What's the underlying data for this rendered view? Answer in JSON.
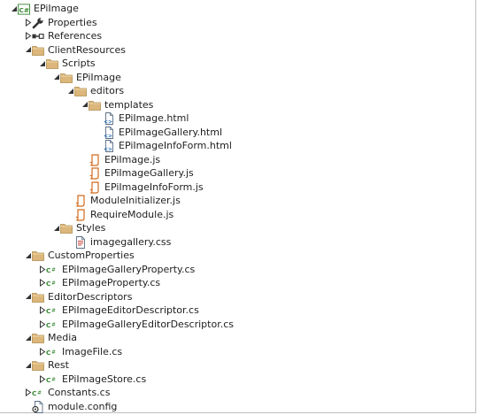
{
  "tree": {
    "items": [
      {
        "label": "EPiImage",
        "icon": "csproj-icon",
        "expander": "expanded"
      },
      {
        "label": "Properties",
        "icon": "wrench-icon",
        "expander": "collapsed"
      },
      {
        "label": "References",
        "icon": "references-icon",
        "expander": "collapsed"
      },
      {
        "label": "ClientResources",
        "icon": "folder-icon",
        "expander": "expanded"
      },
      {
        "label": "Scripts",
        "icon": "folder-icon",
        "expander": "expanded"
      },
      {
        "label": "EPiImage",
        "icon": "folder-icon",
        "expander": "expanded"
      },
      {
        "label": "editors",
        "icon": "folder-icon",
        "expander": "expanded"
      },
      {
        "label": "templates",
        "icon": "folder-icon",
        "expander": "expanded"
      },
      {
        "label": "EPiImage.html",
        "icon": "html-file-icon",
        "expander": "none"
      },
      {
        "label": "EPiImageGallery.html",
        "icon": "html-file-icon",
        "expander": "none"
      },
      {
        "label": "EPiImageInfoForm.html",
        "icon": "html-file-icon",
        "expander": "none"
      },
      {
        "label": "EPiImage.js",
        "icon": "js-file-icon",
        "expander": "none"
      },
      {
        "label": "EPiImageGallery.js",
        "icon": "js-file-icon",
        "expander": "none"
      },
      {
        "label": "EPiImageInfoForm.js",
        "icon": "js-file-icon",
        "expander": "none"
      },
      {
        "label": "ModuleInitializer.js",
        "icon": "js-file-icon",
        "expander": "none"
      },
      {
        "label": "RequireModule.js",
        "icon": "js-file-icon",
        "expander": "none"
      },
      {
        "label": "Styles",
        "icon": "folder-icon",
        "expander": "expanded"
      },
      {
        "label": "imagegallery.css",
        "icon": "css-file-icon",
        "expander": "none"
      },
      {
        "label": "CustomProperties",
        "icon": "folder-icon",
        "expander": "expanded"
      },
      {
        "label": "EPiImageGalleryProperty.cs",
        "icon": "cs-file-icon",
        "expander": "collapsed"
      },
      {
        "label": "EPiImageProperty.cs",
        "icon": "cs-file-icon",
        "expander": "collapsed"
      },
      {
        "label": "EditorDescriptors",
        "icon": "folder-icon",
        "expander": "expanded"
      },
      {
        "label": "EPiImageEditorDescriptor.cs",
        "icon": "cs-file-icon",
        "expander": "collapsed"
      },
      {
        "label": "EPiImageGalleryEditorDescriptor.cs",
        "icon": "cs-file-icon",
        "expander": "collapsed"
      },
      {
        "label": "Media",
        "icon": "folder-icon",
        "expander": "expanded"
      },
      {
        "label": "ImageFile.cs",
        "icon": "cs-file-icon",
        "expander": "collapsed"
      },
      {
        "label": "Rest",
        "icon": "folder-icon",
        "expander": "expanded"
      },
      {
        "label": "EPiImageStore.cs",
        "icon": "cs-file-icon",
        "expander": "collapsed"
      },
      {
        "label": "Constants.cs",
        "icon": "cs-file-icon",
        "expander": "collapsed"
      },
      {
        "label": "module.config",
        "icon": "config-file-icon",
        "expander": "none"
      }
    ]
  },
  "colors": {
    "text": "#1e1e1e",
    "folder": "#dcb67a",
    "csharp_green": "#388a34",
    "js_orange": "#d26b1d",
    "html_blue": "#2a6fb5",
    "border": "#bdbdbd"
  }
}
